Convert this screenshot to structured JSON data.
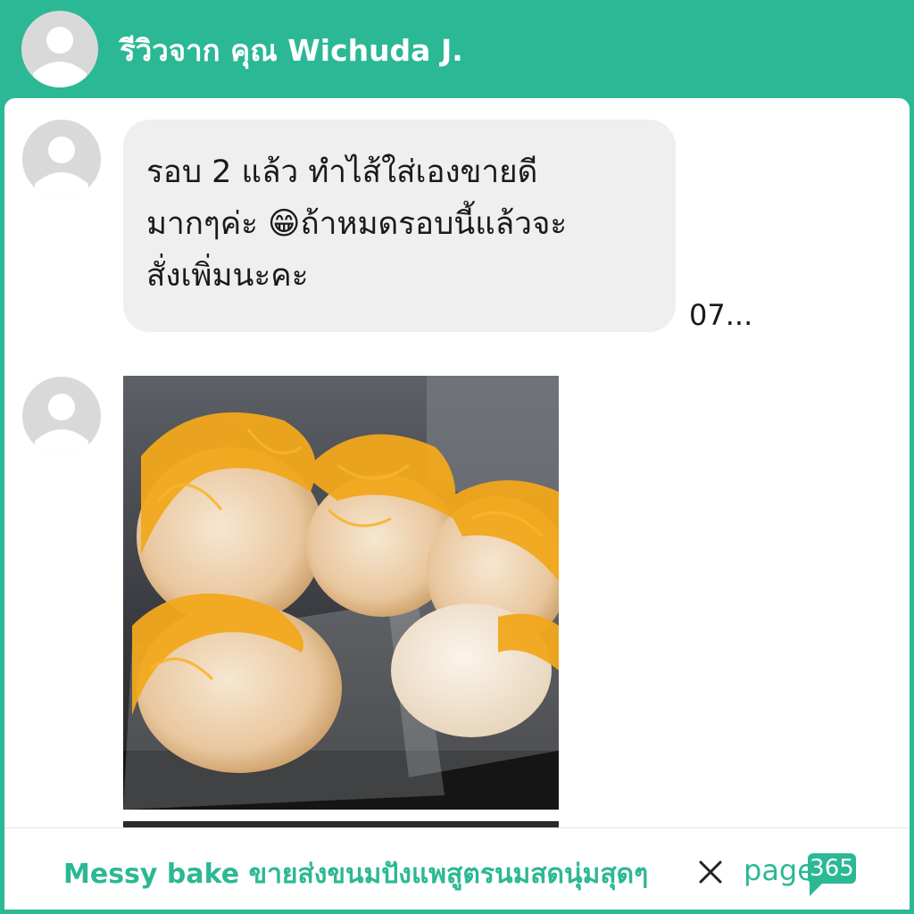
{
  "header": {
    "title": "รีวิวจาก คุณ Wichuda J.",
    "avatar_icon": "user-avatar-icon"
  },
  "messages": [
    {
      "type": "text",
      "avatar_icon": "user-avatar-icon",
      "lines": [
        "รอบ 2 แล้ว ทำไส้ใส่เองขายดี",
        "มากๆค่ะ 😁ถ้าหมดรอบนี้แล้วจะ",
        "สั่งเพิ่มนะคะ"
      ],
      "time": "07..."
    },
    {
      "type": "image",
      "avatar_icon": "user-avatar-icon",
      "image_subject": "bread-rolls-with-golden-egg-threads"
    }
  ],
  "footer": {
    "shop_name": "Messy bake ขายส่งขนมปังแพสูตรนมสดนุ่มสุดๆ",
    "close_icon": "close-icon",
    "brand_text": "page",
    "brand_number": "365"
  },
  "colors": {
    "brand_green": "#2bb894",
    "bubble_bg": "#efefef",
    "avatar_bg": "#d9d9d9"
  }
}
